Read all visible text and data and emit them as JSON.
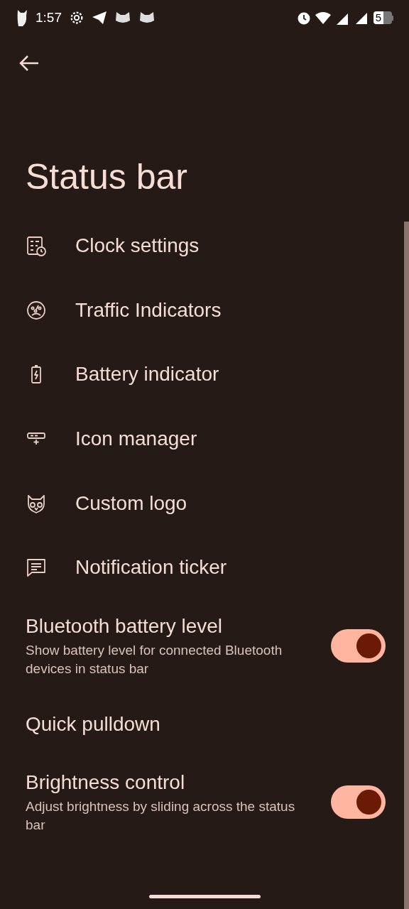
{
  "status_bar": {
    "time": "1:57",
    "battery": "5"
  },
  "title": "Status bar",
  "items": [
    {
      "kind": "link",
      "label": "Clock settings"
    },
    {
      "kind": "link",
      "label": "Traffic Indicators"
    },
    {
      "kind": "link",
      "label": "Battery indicator"
    },
    {
      "kind": "link",
      "label": "Icon manager"
    },
    {
      "kind": "link",
      "label": "Custom logo"
    },
    {
      "kind": "link",
      "label": "Notification ticker"
    },
    {
      "kind": "switch",
      "label": "Bluetooth battery level",
      "summary": "Show battery level for connected Bluetooth devices in status bar",
      "on": true
    },
    {
      "kind": "plain",
      "label": "Quick pulldown"
    },
    {
      "kind": "switch",
      "label": "Brightness control",
      "summary": "Adjust brightness by sliding across the status bar",
      "on": true
    }
  ]
}
